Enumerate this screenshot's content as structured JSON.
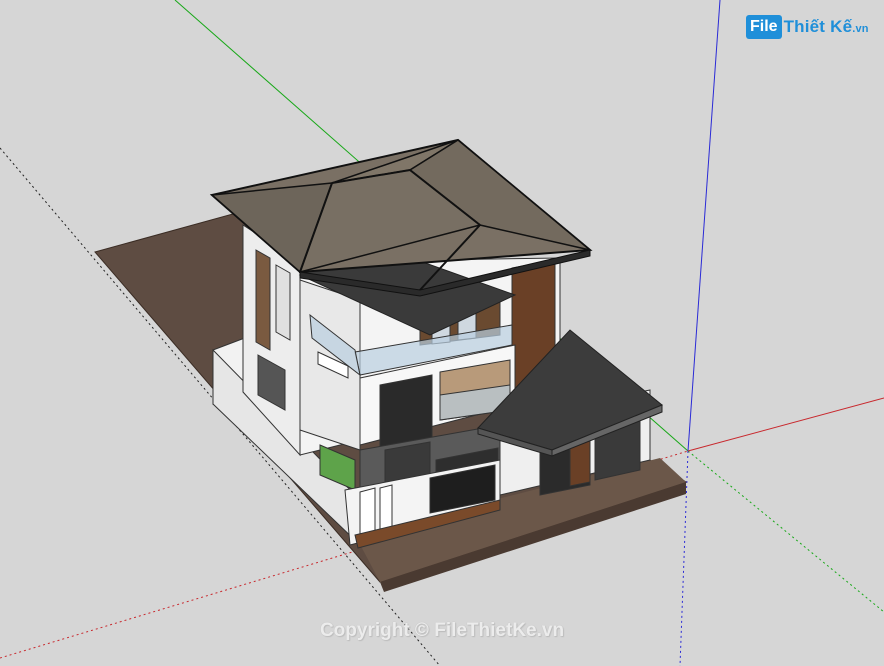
{
  "logo": {
    "box_text": "File",
    "text": "Thiết Kế",
    "suffix": ".vn"
  },
  "copyright": "Copyright © FileThietKe.vn",
  "colors": {
    "background": "#d6d6d6",
    "axis_red": "#c8282d",
    "axis_green": "#18a818",
    "axis_blue": "#2a2ad6",
    "roof": "#6f665b",
    "ground": "#5e4c42",
    "wood": "#6a4026",
    "logo": "#1f8fd9"
  }
}
